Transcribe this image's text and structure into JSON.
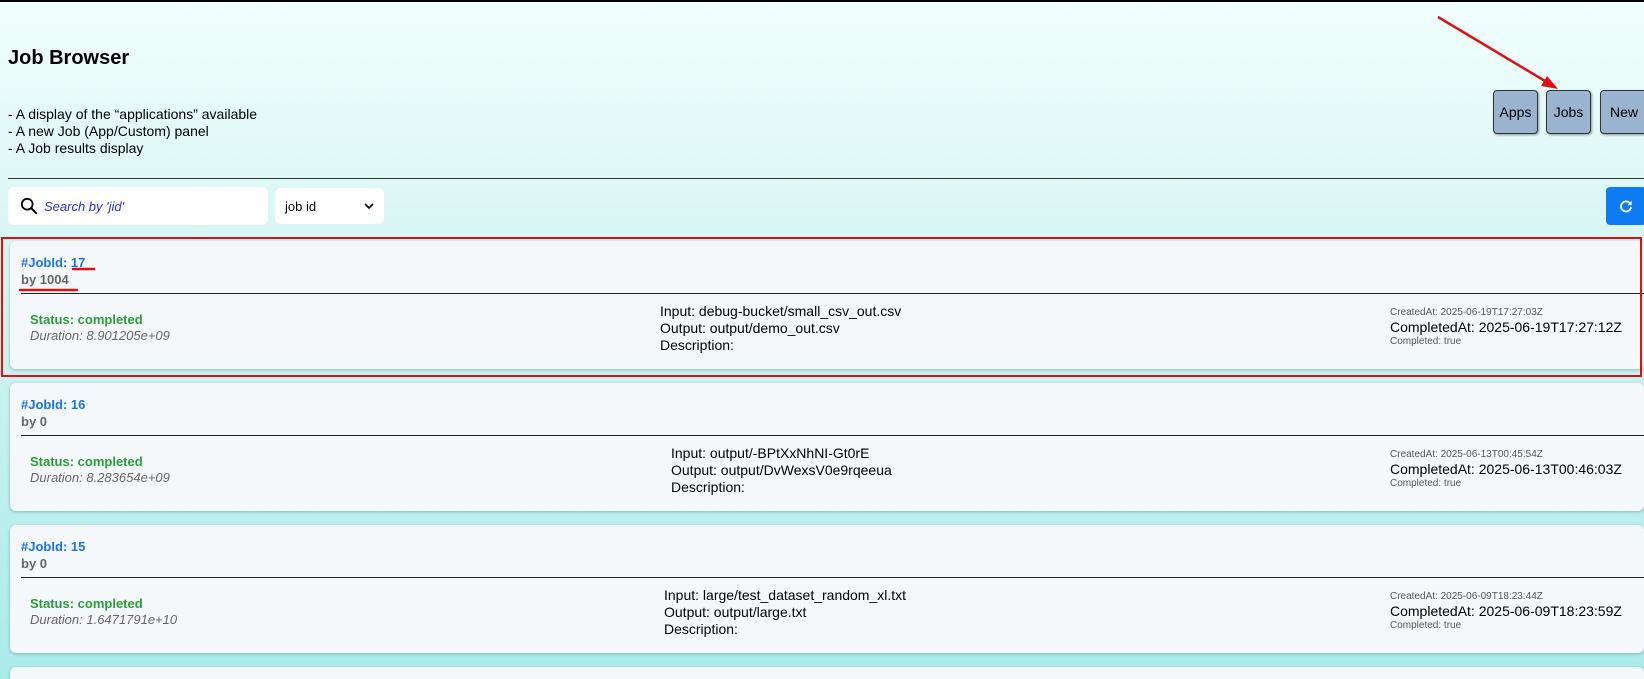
{
  "header": {
    "title": "Job Browser",
    "description_lines": [
      "- A display of the “applications” available",
      "- A new Job (App/Custom) panel",
      "- A Job results display"
    ],
    "nav": {
      "apps_label": "Apps",
      "jobs_label": "Jobs",
      "new_label": "New",
      "button_color": "#9ab3cf"
    }
  },
  "toolbar": {
    "search_placeholder": "Search by 'jid'",
    "search_icon": "search-icon",
    "filter_selected": "job id",
    "refresh_icon": "refresh-icon",
    "refresh_color": "#0d7cf2"
  },
  "jobs": [
    {
      "id_label": "#JobId: 17",
      "by_label": "by 1004",
      "status": "Status: completed",
      "duration": "Duration: 8.901205e+09",
      "input": "Input: debug-bucket/small_csv_out.csv",
      "output": "Output: output/demo_out.csv",
      "description": "Description:",
      "created_at": "CreatedAt: 2025-06-19T17:27:03Z",
      "completed_at": "CompletedAt: 2025-06-19T17:27:12Z",
      "completed_flag": "Completed: true"
    },
    {
      "id_label": "#JobId: 16",
      "by_label": "by 0",
      "status": "Status: completed",
      "duration": "Duration: 8.283654e+09",
      "input": "Input: output/-BPtXxNhNI-Gt0rE",
      "output": "Output: output/DvWexsV0e9rqeeua",
      "description": "Description:",
      "created_at": "CreatedAt: 2025-06-13T00:45:54Z",
      "completed_at": "CompletedAt: 2025-06-13T00:46:03Z",
      "completed_flag": "Completed: true"
    },
    {
      "id_label": "#JobId: 15",
      "by_label": "by 0",
      "status": "Status: completed",
      "duration": "Duration: 1.6471791e+10",
      "input": "Input: large/test_dataset_random_xl.txt",
      "output": "Output: output/large.txt",
      "description": "Description:",
      "created_at": "CreatedAt: 2025-06-09T18:23:44Z",
      "completed_at": "CompletedAt: 2025-06-09T18:23:59Z",
      "completed_flag": "Completed: true"
    }
  ],
  "colors": {
    "status_green": "#2a9d3a",
    "job_id_blue": "#1a73e8",
    "annotation_red": "#e01010"
  }
}
